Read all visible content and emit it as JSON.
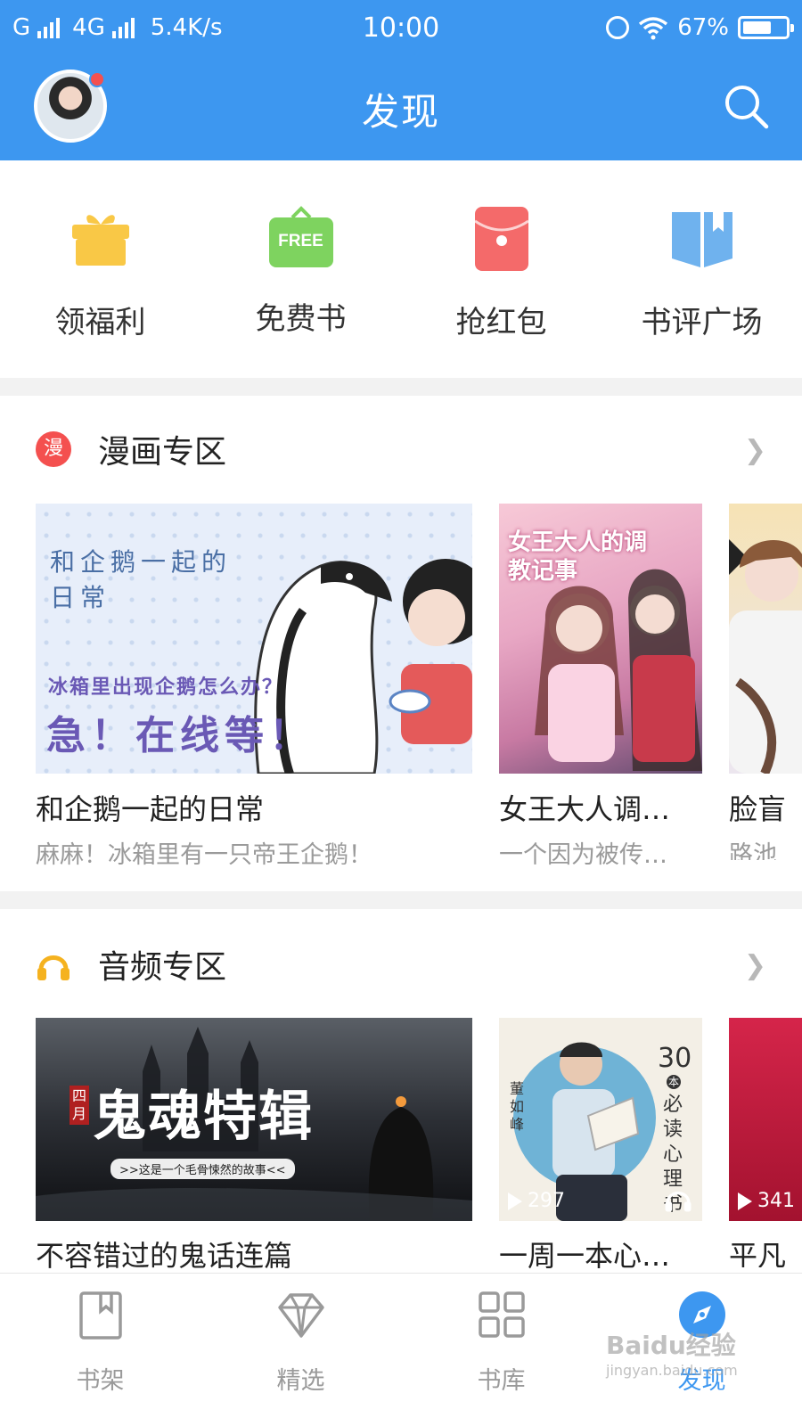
{
  "status_bar": {
    "carrier": "G",
    "network": "4G",
    "speed": "5.4K/s",
    "time": "10:00",
    "battery": "67%",
    "battery_level": 0.67
  },
  "header": {
    "title": "发现",
    "icons": [
      "avatar",
      "search-icon"
    ],
    "background_color": "#3d97f0",
    "notification_dot_color": "#f4504f"
  },
  "quick_actions": [
    {
      "label": "领福利",
      "icon": "gift-icon",
      "color": "#f9c846"
    },
    {
      "label": "免费书",
      "icon": "free-bag-icon",
      "icon_text": "FREE",
      "color": "#7ed35f"
    },
    {
      "label": "抢红包",
      "icon": "red-envelope-icon",
      "color": "#f46a6a"
    },
    {
      "label": "书评广场",
      "icon": "book-review-icon",
      "color": "#6fb2ee"
    }
  ],
  "comic_section": {
    "badge": "漫",
    "title": "漫画专区",
    "more_icon": "chevron-right-icon",
    "items": [
      {
        "title": "和企鹅一起的日常",
        "desc": "麻麻！冰箱里有一只帝王企鹅！",
        "cover_text_top": "和企鹅一起的日常",
        "cover_text_sub": "冰箱里出现企鹅怎么办？",
        "cover_text_big": "急！在线等！"
      },
      {
        "title": "女王大人调…",
        "desc": "一个因为被传…",
        "cover_text": "女王大人的调教记事"
      },
      {
        "title": "脸盲",
        "desc": "路池"
      }
    ]
  },
  "audio_section": {
    "title": "音频专区",
    "icon": "headphones-icon",
    "more_icon": "chevron-right-icon",
    "items": [
      {
        "title": "不容错过的鬼话连篇",
        "cover_badge": "四月",
        "cover_title": "鬼魂特辑",
        "cover_sub": ">>这是一个毛骨悚然的故事<<"
      },
      {
        "title": "一周一本心…",
        "cover_author": "董如峰",
        "cover_number": "30",
        "cover_unit": "本",
        "cover_text": "必读心理书",
        "plays": "297"
      },
      {
        "title": "平凡",
        "plays": "341"
      }
    ]
  },
  "bottom_nav": [
    {
      "label": "书架",
      "icon": "bookshelf-icon",
      "active": false
    },
    {
      "label": "精选",
      "icon": "diamond-icon",
      "active": false
    },
    {
      "label": "书库",
      "icon": "grid-icon",
      "active": false
    },
    {
      "label": "发现",
      "icon": "discover-icon",
      "active": true
    }
  ],
  "watermark": {
    "text": "Baidu经验",
    "sub": "jingyan.baidu.com"
  }
}
